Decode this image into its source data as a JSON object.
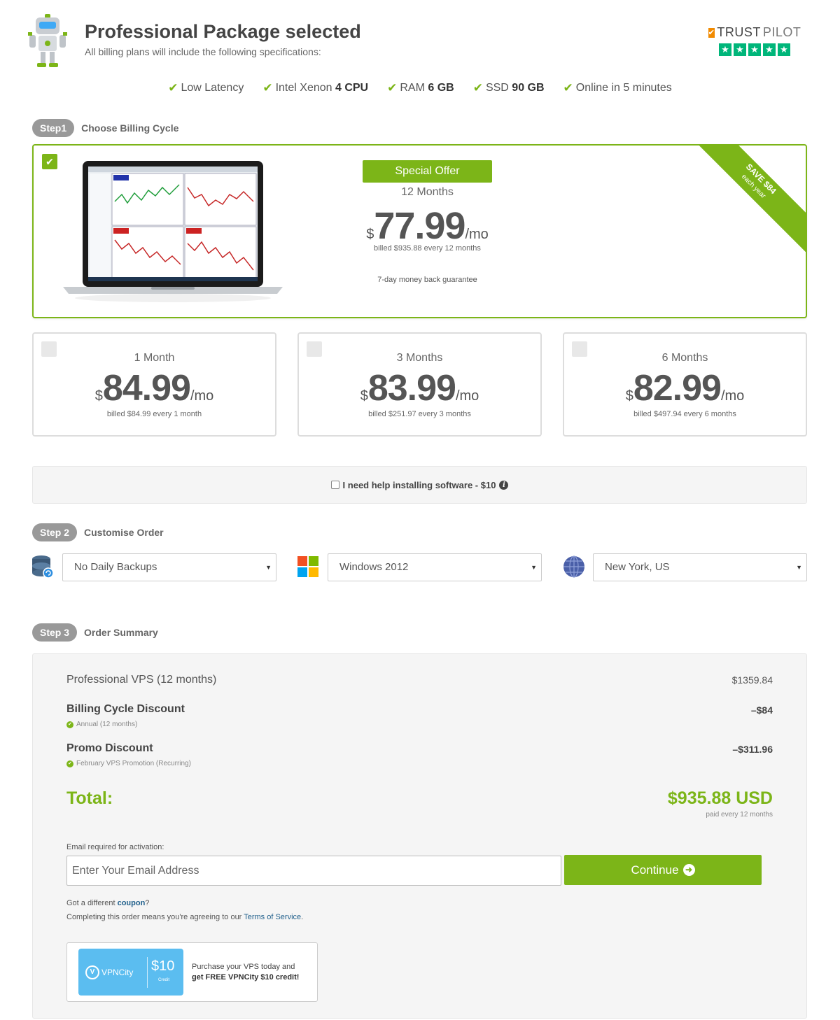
{
  "header": {
    "title": "Professional Package selected",
    "subtitle": "All billing plans will include the following specifications:"
  },
  "trustpilot": {
    "label_trust": "TRUST",
    "label_pilot": "PILOT",
    "stars": 5
  },
  "specs": [
    {
      "text": "Low Latency",
      "bold": ""
    },
    {
      "text": "Intel Xenon ",
      "bold": "4 CPU"
    },
    {
      "text": "RAM ",
      "bold": "6 GB"
    },
    {
      "text": "SSD ",
      "bold": "90 GB"
    },
    {
      "text": "Online in 5 minutes",
      "bold": ""
    }
  ],
  "step1": {
    "pill": "Step1",
    "label": "Choose Billing Cycle"
  },
  "featured": {
    "badge": "Special Offer",
    "months": "12 Months",
    "currency": "$",
    "price": "77.99",
    "per": "/mo",
    "billed": "billed $935.88 every 12 months",
    "guarantee": "7-day money back guarantee",
    "ribbon_main": "SAVE $84",
    "ribbon_sub": "each year",
    "selected": true
  },
  "plans": [
    {
      "months": "1 Month",
      "currency": "$",
      "price": "84.99",
      "per": "/mo",
      "billed": "billed $84.99 every 1 month"
    },
    {
      "months": "3 Months",
      "currency": "$",
      "price": "83.99",
      "per": "/mo",
      "billed": "billed $251.97 every 3 months"
    },
    {
      "months": "6 Months",
      "currency": "$",
      "price": "82.99",
      "per": "/mo",
      "billed": "billed $497.94 every 6 months"
    }
  ],
  "help": {
    "label": "I need help installing software - $10"
  },
  "step2": {
    "pill": "Step 2",
    "label": "Customise Order"
  },
  "selects": {
    "backups": "No Daily Backups",
    "os": "Windows 2012",
    "location": "New York, US"
  },
  "step3": {
    "pill": "Step 3",
    "label": "Order Summary"
  },
  "summary": {
    "vps_label": "Professional VPS (12 months)",
    "vps_value": "$1359.84",
    "cycle_label": "Billing Cycle Discount",
    "cycle_sub": "Annual (12 months)",
    "cycle_value": "–$84",
    "promo_label": "Promo Discount",
    "promo_sub": "February VPS Promotion (Recurring)",
    "promo_value": "–$311.96",
    "total_label": "Total:",
    "total_value": "$935.88 USD",
    "total_sub": "paid every 12 months",
    "email_label": "Email required for activation:",
    "email_placeholder": "Enter Your Email Address",
    "continue_label": "Continue",
    "coupon_pre": "Got a different ",
    "coupon_link": "coupon",
    "coupon_post": "?",
    "terms_pre": "Completing this order means you're agreeing to our ",
    "terms_link": "Terms of Service",
    "terms_post": "."
  },
  "vpncity": {
    "brand": "VPNCity",
    "amount": "$10",
    "credit": "Credit",
    "line1": "Purchase your VPS today and",
    "line2": "get FREE VPNCity $10 credit!"
  },
  "colors": {
    "accent": "#7cb518",
    "trustpilot": "#00b67a",
    "link": "#1f5f8b"
  },
  "icons": [
    "robot-mascot-icon",
    "check-icon",
    "database-icon",
    "windows-icon",
    "globe-icon",
    "info-icon",
    "arrow-circle-right-icon",
    "chevron-down-icon"
  ]
}
